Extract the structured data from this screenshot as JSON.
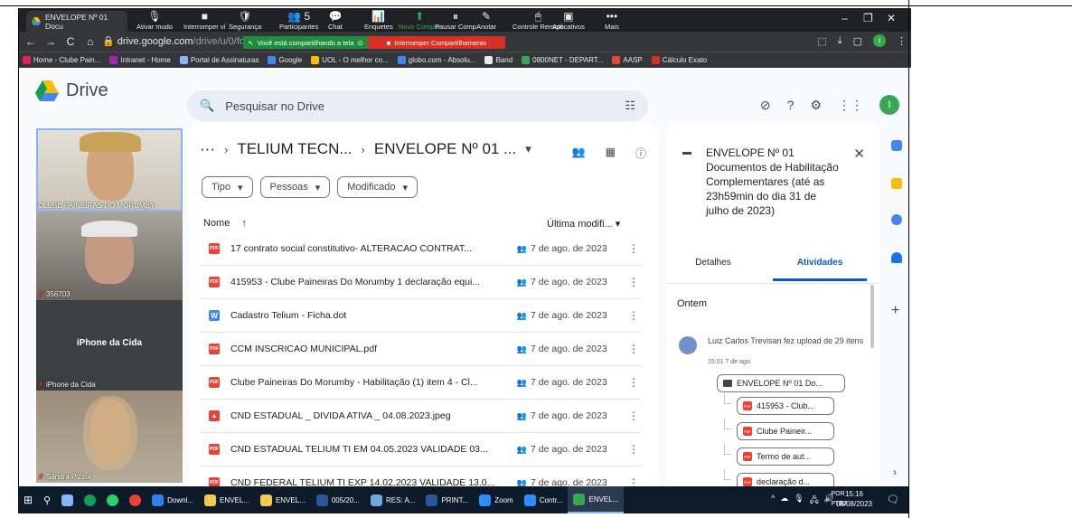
{
  "browser": {
    "tab_title": "ENVELOPE Nº 01 Docu",
    "url_host": "drive.google.com",
    "url_path": "/drive/u/0/folders/1pltHa",
    "window_controls": [
      "–",
      "❐",
      "✕"
    ]
  },
  "meet_toolbar": {
    "buttons": [
      {
        "label": "Ativar mudo",
        "icon": "🎙"
      },
      {
        "label": "Interromper ví",
        "icon": "■"
      },
      {
        "label": "Segurança",
        "icon": "🛡"
      },
      {
        "label": "Participantes",
        "icon": "👥",
        "count": "5"
      },
      {
        "label": "Chat",
        "icon": "💬"
      },
      {
        "label": "Enquetes",
        "icon": "📊"
      },
      {
        "label": "Novo Compar",
        "icon": "⬆"
      },
      {
        "label": "Pausar Comp",
        "icon": "⏸"
      },
      {
        "label": "Anotar",
        "icon": "✎"
      },
      {
        "label": "Controle Remoto",
        "icon": "🖱"
      },
      {
        "label": "Aplicativos",
        "icon": "▣"
      },
      {
        "label": "Mais",
        "icon": "•••"
      }
    ],
    "sharing_text": "Você está compartilhando a tela",
    "stop_sharing": "Interromper Compartilhamento"
  },
  "bookmarks": [
    {
      "label": "Home - Clube Pain...",
      "color": "#e91e63"
    },
    {
      "label": "Intranet - Home",
      "color": "#9c27b0"
    },
    {
      "label": "Portal de Assinaturas",
      "color": "#8ab4f8"
    },
    {
      "label": "Google",
      "color": "#4285f4"
    },
    {
      "label": "UOL - O melhor co...",
      "color": "#fbbc04"
    },
    {
      "label": "globo.com - Absolu...",
      "color": "#4285f4"
    },
    {
      "label": "Band",
      "color": "#e8eaed"
    },
    {
      "label": "0800NET - DEPART...",
      "color": "#34a853"
    },
    {
      "label": "AASP",
      "color": "#ea4335"
    },
    {
      "label": "Cálculo Exato",
      "color": "#d93025"
    }
  ],
  "drive": {
    "app_name": "Drive",
    "search_placeholder": "Pesquisar no Drive",
    "user_initial": "I",
    "breadcrumb": {
      "more": "···",
      "parent": "TELIUM TECN...",
      "current": "ENVELOPE Nº 01 ..."
    },
    "filters": [
      "Tipo",
      "Pessoas",
      "Modificado"
    ],
    "columns": {
      "name": "Nome",
      "modified": "Última modifi..."
    },
    "files": [
      {
        "type": "PDF",
        "name": "17 contrato social constitutivo- ALTERACAO CONTRAT...",
        "date": "7 de ago. de 2023"
      },
      {
        "type": "PDF",
        "name": "415953 - Clube Paineiras Do Morumby 1 declaração equi...",
        "date": "7 de ago. de 2023"
      },
      {
        "type": "W",
        "name": "Cadastro Telium - Ficha.dot",
        "date": "7 de ago. de 2023"
      },
      {
        "type": "PDF",
        "name": "CCM INSCRICAO MUNICIPAL.pdf",
        "date": "7 de ago. de 2023"
      },
      {
        "type": "PDF",
        "name": "Clube Paineiras Do Morumby - Habilitação (1) item 4 - Cl...",
        "date": "7 de ago. de 2023"
      },
      {
        "type": "IMG",
        "name": "CND ESTADUAL _ DIVIDA ATIVA _ 04.08.2023.jpeg",
        "date": "7 de ago. de 2023"
      },
      {
        "type": "PDF",
        "name": "CND ESTADUAL TELIUM TI EM 04.05.2023 VALIDADE 03...",
        "date": "7 de ago. de 2023"
      },
      {
        "type": "PDF",
        "name": "CND FEDERAL TELIUM TI EXP 14.02.2023 VALIDADE 13.0...",
        "date": "7 de ago. de 2023"
      }
    ]
  },
  "details_panel": {
    "title": "ENVELOPE Nº 01 Documentos de Habilitação Complementares (até as 23h59min do dia 31 de julho de 2023)",
    "tab_details": "Detalhes",
    "tab_activities": "Atividades",
    "section": "Ontem",
    "activity_text": "Luiz Carlos Trevisan fez upload de 29 itens",
    "activity_time": "15:01 7 de ago.",
    "folder_chip": "ENVELOPE Nº 01 Do...",
    "file_chips": [
      "415953 - Club...",
      "Clube Paineir...",
      "Termo de aut...",
      "declaração d..."
    ]
  },
  "meet_tiles": [
    {
      "name": "CLUBE PAINEIRAS DO MORUMBY"
    },
    {
      "name": "356703"
    },
    {
      "name": "iPhone da Cida",
      "center_name": "iPhone da Cida"
    },
    {
      "name": "Sandra Pizzol"
    }
  ],
  "taskbar": {
    "items": [
      {
        "label": "Downl...",
        "color": "#2f80ed"
      },
      {
        "label": "ENVEL...",
        "color": "#f2c94c"
      },
      {
        "label": "ENVEL...",
        "color": "#f2c94c"
      },
      {
        "label": "005/20...",
        "color": "#2b579a"
      },
      {
        "label": "RES: A...",
        "color": "#6fa8dc"
      },
      {
        "label": "PRINT...",
        "color": "#2b579a"
      },
      {
        "label": "Zoom",
        "color": "#2d8cff"
      },
      {
        "label": "Contr...",
        "color": "#2d8cff"
      },
      {
        "label": "ENVEL...",
        "color": "#34a853"
      }
    ],
    "lang": "POR",
    "lang2": "PTB2",
    "time": "15:16",
    "date": "08/08/2023"
  }
}
